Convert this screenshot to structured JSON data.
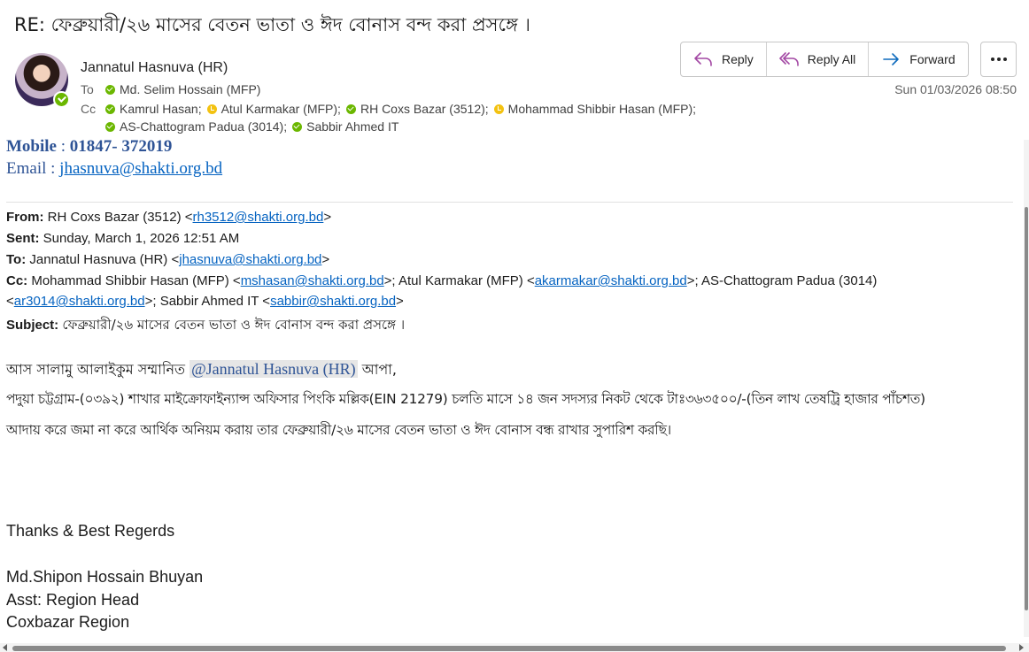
{
  "subject": "RE:  ফেব্রুয়ারী/২৬ মাসের বেতন ভাতা ও ঈদ বোনাস বন্দ করা প্রসঙ্গে ।",
  "sender": {
    "name": "Jannatul Hasnuva (HR)"
  },
  "to": {
    "label": "To",
    "recipients": [
      {
        "name": "Md. Selim Hossain (MFP)",
        "status": "available"
      }
    ]
  },
  "cc": {
    "label": "Cc",
    "line1": [
      {
        "name": "Kamrul Hasan;",
        "status": "available"
      },
      {
        "name": "Atul  Karmakar (MFP);",
        "status": "away"
      },
      {
        "name": "RH Coxs Bazar (3512);",
        "status": "available"
      },
      {
        "name": "Mohammad Shibbir Hasan (MFP);",
        "status": "away"
      }
    ],
    "line2": [
      {
        "name": "AS-Chattogram Padua  (3014);",
        "status": "available"
      },
      {
        "name": "Sabbir Ahmed IT",
        "status": "available"
      }
    ]
  },
  "actions": {
    "reply": "Reply",
    "reply_all": "Reply All",
    "forward": "Forward"
  },
  "timestamp": "Sun 01/03/2026 08:50",
  "signature_top": {
    "mobile_label": "Mobile",
    "mobile_value": "01847- 372019",
    "email_label": "Email",
    "email_value": "jhasnuva@shakti.org.bd"
  },
  "forwarded": {
    "from_label": "From:",
    "from_name": "RH Coxs Bazar (3512) <",
    "from_email": "rh3512@shakti.org.bd",
    "sent_label": "Sent:",
    "sent_value": "Sunday, March 1, 2026 12:51 AM",
    "to_label": "To:",
    "to_name": "Jannatul Hasnuva (HR) <",
    "to_email": "jhasnuva@shakti.org.bd",
    "cc_label": "Cc:",
    "cc_1_name": "Mohammad Shibbir Hasan (MFP) <",
    "cc_1_email": "mshasan@shakti.org.bd",
    "cc_2_name": ">; Atul Karmakar (MFP) <",
    "cc_2_email": "akarmakar@shakti.org.bd",
    "cc_3_name": ">; AS-Chattogram Padua (3014)",
    "cc_4_email": "ar3014@shakti.org.bd",
    "cc_5_name": ">; Sabbir Ahmed IT <",
    "cc_5_email": "sabbir@shakti.org.bd",
    "subject_label": "Subject:",
    "subject_value": "ফেব্রুয়ারী/২৬ মাসের বেতন ভাতা ও ঈদ বোনাস বন্দ করা প্রসঙ্গে ।"
  },
  "body": {
    "greeting_pre": "আস সালামু আলাইকুম সম্মানিত ",
    "mention": "@Jannatul Hasnuva (HR)",
    "greeting_post": " আপা,",
    "line2": "পদুয়া চট্টগ্রাম-(০৩৯২) শাখার মাইক্রোফাইন্যান্স অফিসার পিংকি মল্লিক(EIN 21279)  চলতি মাসে ১৪ জন সদস্যর নিকট থেকে টাঃ৩৬৩৫০০/-(তিন লাখ তেষট্রি হাজার পাঁচশত)",
    "line3": "আদায় করে জমা না করে আর্থিক অনিয়ম করায় তার ফেব্রুয়ারী/২৬ মাসের বেতন ভাতা ও ঈদ বোনাস বন্ধ রাখার সুপারিশ করছি।",
    "thanks": "Thanks & Best Regerds",
    "sig_name": "Md.Shipon Hossain Bhuyan",
    "sig_title": "Asst: Region Head",
    "sig_region": "Coxbazar Region"
  }
}
